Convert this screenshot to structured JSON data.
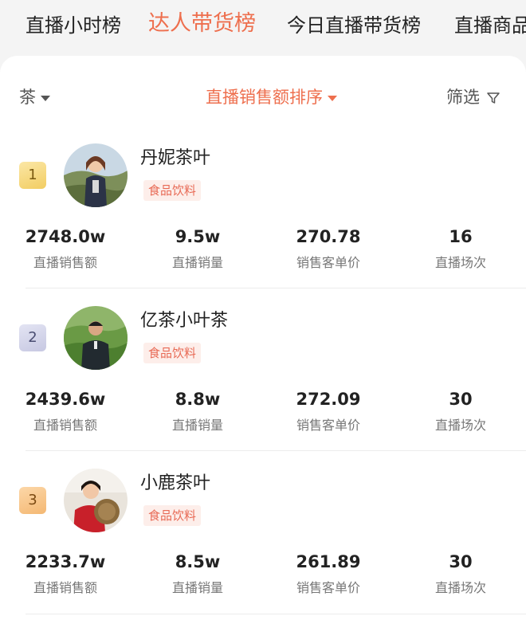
{
  "tabs": [
    {
      "label": "直播小时榜",
      "active": false
    },
    {
      "label": "达人带货榜",
      "active": true
    },
    {
      "label": "今日直播带货榜",
      "active": false
    },
    {
      "label": "直播商品",
      "active": false
    }
  ],
  "filters": {
    "category": "茶",
    "sort": "直播销售额排序",
    "screen": "筛选"
  },
  "colors": {
    "accent": "#ee6f4e",
    "tag_bg": "#fdeeea",
    "tag_text": "#e86a55"
  },
  "stat_labels": [
    "直播销售额",
    "直播销量",
    "销售客单价",
    "直播场次"
  ],
  "rankings": [
    {
      "rank": "1",
      "name": "丹妮茶叶",
      "tag": "食品饮料",
      "stats": [
        "2748.0w",
        "9.5w",
        "270.78",
        "16"
      ]
    },
    {
      "rank": "2",
      "name": "亿茶小叶茶",
      "tag": "食品饮料",
      "stats": [
        "2439.6w",
        "8.8w",
        "272.09",
        "30"
      ]
    },
    {
      "rank": "3",
      "name": "小鹿茶叶",
      "tag": "食品饮料",
      "stats": [
        "2233.7w",
        "8.5w",
        "261.89",
        "30"
      ]
    }
  ]
}
